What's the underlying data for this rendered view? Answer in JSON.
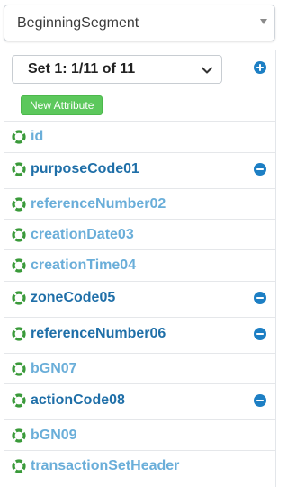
{
  "segment_select": {
    "value": "BeginningSegment"
  },
  "set_select": {
    "value": "Set 1: 1/11 of 11"
  },
  "new_attribute_button": "New Attribute",
  "attributes": [
    {
      "name": "id",
      "required": false,
      "removable": false
    },
    {
      "name": "purposeCode01",
      "required": true,
      "removable": true
    },
    {
      "name": "referenceNumber02",
      "required": false,
      "removable": false
    },
    {
      "name": "creationDate03",
      "required": false,
      "removable": false
    },
    {
      "name": "creationTime04",
      "required": false,
      "removable": false
    },
    {
      "name": "zoneCode05",
      "required": true,
      "removable": true
    },
    {
      "name": "referenceNumber06",
      "required": true,
      "removable": true
    },
    {
      "name": "bGN07",
      "required": false,
      "removable": false
    },
    {
      "name": "actionCode08",
      "required": true,
      "removable": true
    },
    {
      "name": "bGN09",
      "required": false,
      "removable": false
    },
    {
      "name": "transactionSetHeader",
      "required": false,
      "removable": false
    }
  ],
  "icons": {
    "attribute": "lifebuoy-icon",
    "remove": "minus-circle-icon",
    "add": "plus-circle-icon"
  },
  "colors": {
    "required_text": "#1f6fa8",
    "optional_text": "#6aaed9",
    "ring_green": "#3a9a3a",
    "button_green": "#5cc85c",
    "action_blue": "#1d7fc4"
  }
}
